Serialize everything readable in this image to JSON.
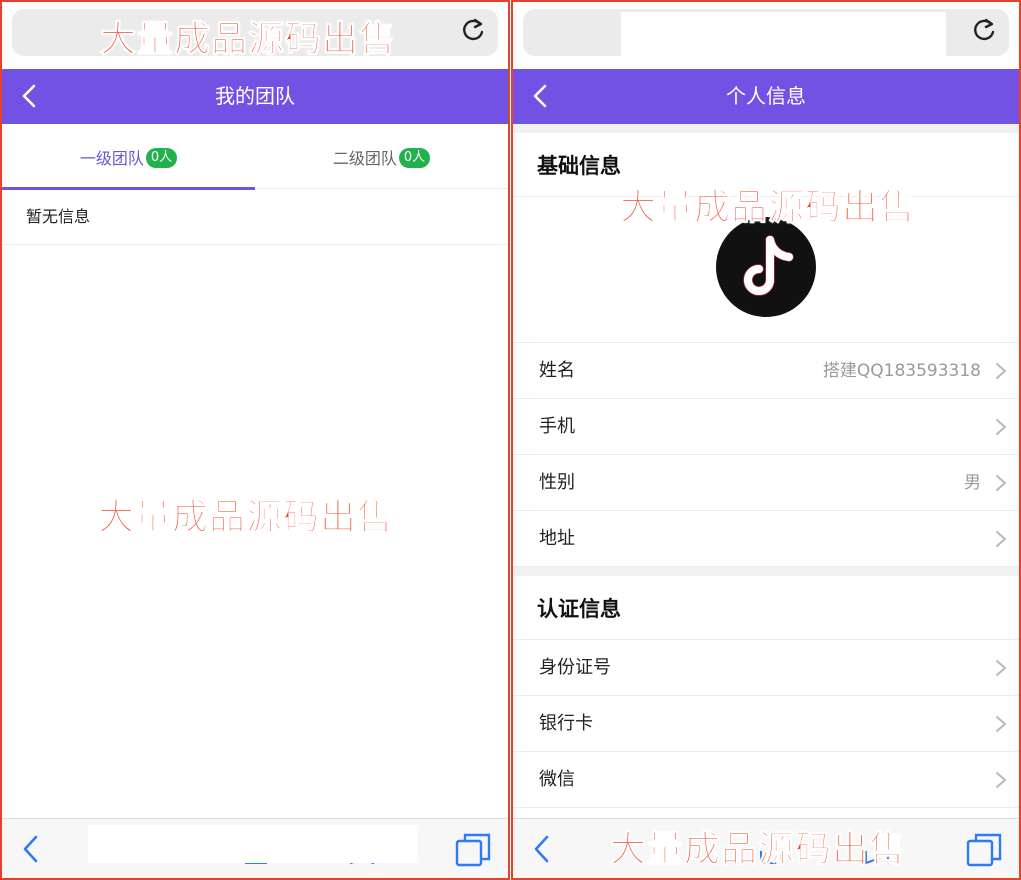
{
  "watermark": {
    "text": "大量成品源码出售"
  },
  "left_screen": {
    "header": {
      "title": "我的团队"
    },
    "tabs": [
      {
        "label": "一级团队",
        "badge": "0人",
        "active": true
      },
      {
        "label": "二级团队",
        "badge": "0人",
        "active": false
      }
    ],
    "empty_message": "暂无信息"
  },
  "right_screen": {
    "header": {
      "title": "个人信息"
    },
    "basic_section": {
      "title": "基础信息",
      "rows": [
        {
          "label": "姓名",
          "value": "搭建QQ183593318"
        },
        {
          "label": "手机",
          "value": ""
        },
        {
          "label": "性别",
          "value": "男"
        },
        {
          "label": "地址",
          "value": ""
        }
      ]
    },
    "auth_section": {
      "title": "认证信息",
      "rows": [
        {
          "label": "身份证号",
          "value": ""
        },
        {
          "label": "银行卡",
          "value": ""
        },
        {
          "label": "微信",
          "value": ""
        }
      ]
    }
  },
  "icons": {
    "reload": "reload-icon",
    "back": "chevron-left-icon",
    "row_chevron": "chevron-right-icon",
    "tabs": "tabs-icon",
    "avatar": "tiktok-logo"
  },
  "colors": {
    "header_purple": "#7152e4",
    "badge_green": "#22b24c",
    "watermark_red": "#f0401f",
    "frame_red": "#e8412a"
  }
}
